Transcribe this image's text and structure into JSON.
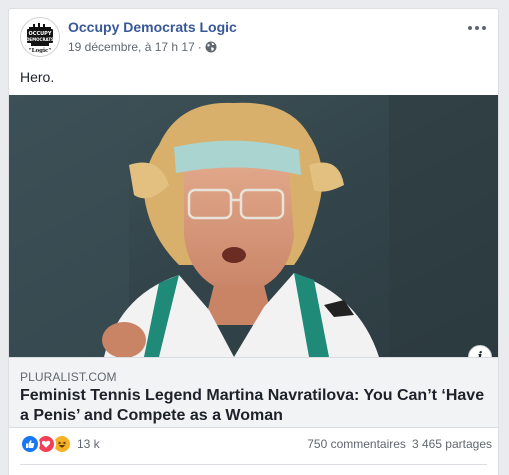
{
  "post": {
    "page_name": "Occupy Democrats Logic",
    "date": "19 décembre, à 17 h 17",
    "separator": "·",
    "privacy_icon": "globe-icon",
    "caption": "Hero.",
    "avatar": {
      "line1": "OCCUPY",
      "line2": "DEMOCRATS",
      "line3": "\"Logic\""
    }
  },
  "link": {
    "domain": "PLURALIST.COM",
    "title": "Feminist Tennis Legend Martina Navratilova: You Can’t ‘Have a Penis’ and Compete as a Woman",
    "info_label": "i"
  },
  "stats": {
    "reactions_count": "13 k",
    "reaction_icons": [
      "like-icon",
      "love-icon",
      "haha-icon"
    ],
    "comments": "750 commentaires",
    "shares": "3 465 partages"
  },
  "colors": {
    "link_blue": "#385898",
    "like_blue": "#1877f2",
    "love_red": "#f33e58",
    "haha_yellow": "#f7b125",
    "background": "#e9ebee"
  }
}
